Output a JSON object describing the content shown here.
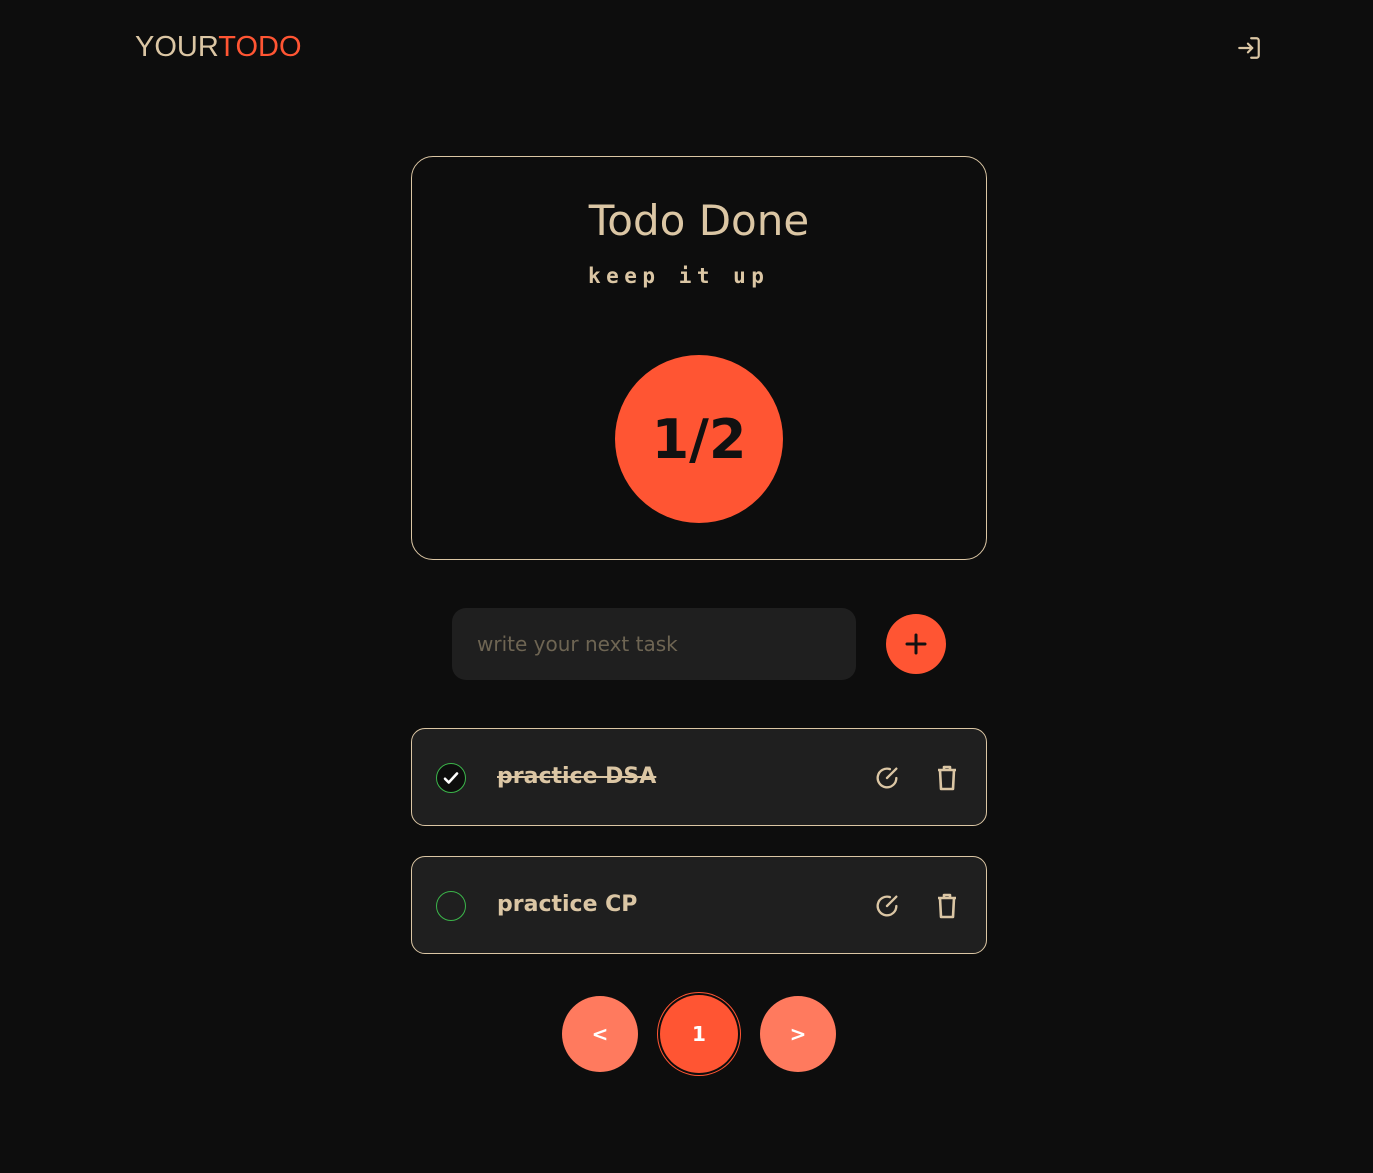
{
  "header": {
    "logo_part1": "YOUR",
    "logo_part2": "TODO",
    "login_icon": "login-icon"
  },
  "stats": {
    "title": "Todo Done",
    "subtitle": "keep it up",
    "progress": "1/2"
  },
  "task_input": {
    "placeholder": "write your next task",
    "value": ""
  },
  "todos": [
    {
      "text": "practice DSA",
      "completed": true
    },
    {
      "text": "practice CP",
      "completed": false
    }
  ],
  "pagination": {
    "prev_label": "<",
    "current_page": "1",
    "next_label": ">"
  },
  "colors": {
    "accent": "#ff5533",
    "text": "#dbc6a4",
    "background": "#0d0d0d",
    "card": "#1f1f1f",
    "check": "#3bb54a"
  }
}
